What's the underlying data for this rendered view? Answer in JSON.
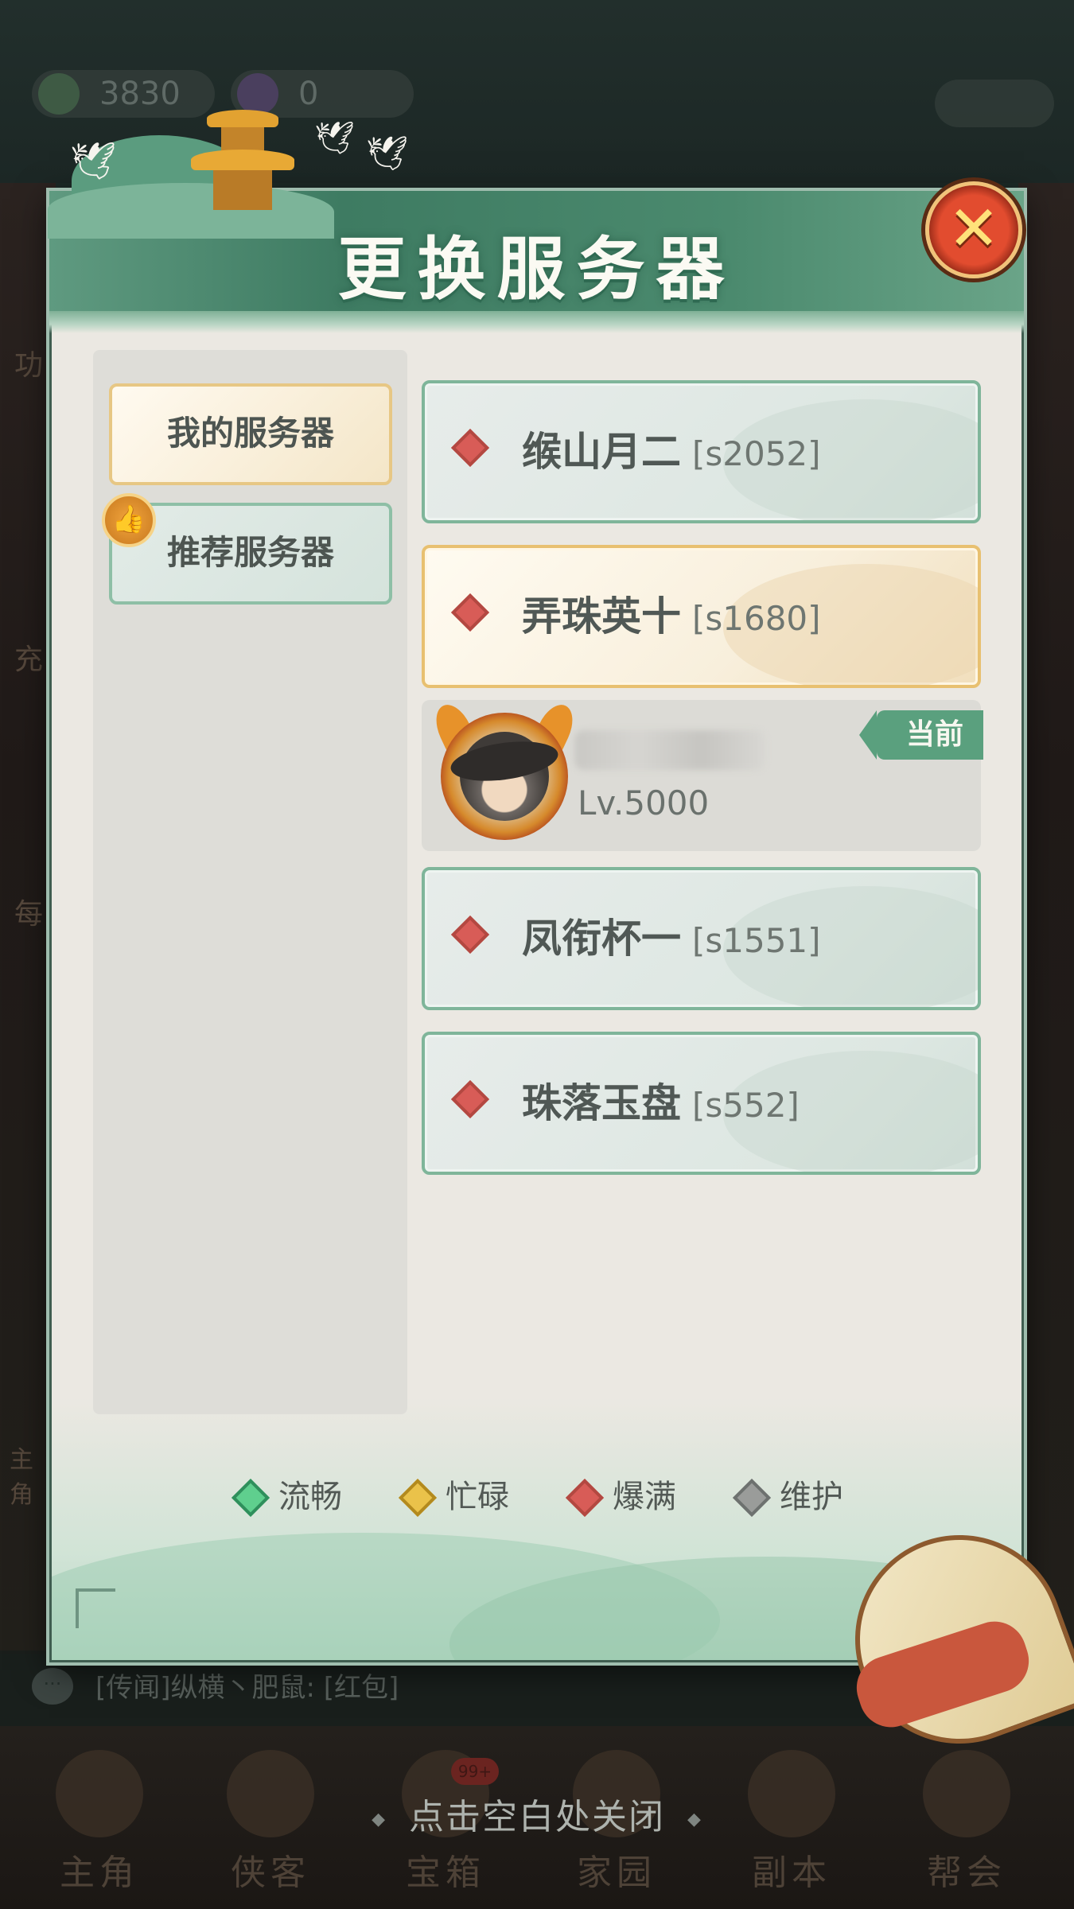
{
  "background": {
    "resource_1": "3830",
    "resource_2": "0",
    "side_left_texts": [
      "功",
      "充",
      "每",
      "主角"
    ],
    "chat": {
      "icon": "chat-bubble-icon",
      "text": "[传闻]纵横丶肥鼠: [红包]"
    },
    "nav": [
      {
        "label": "主角",
        "icon": "hero-icon"
      },
      {
        "label": "侠客",
        "icon": "gourd-icon"
      },
      {
        "label": "宝箱",
        "icon": "chest-icon",
        "badge": "99+"
      },
      {
        "label": "家园",
        "icon": "home-icon"
      },
      {
        "label": "副本",
        "icon": "scroll-map-icon"
      },
      {
        "label": "帮会",
        "icon": "guild-icon"
      }
    ]
  },
  "dialog": {
    "title": "更换服务器",
    "close_icon": "close-x-icon",
    "tabs": [
      {
        "label": "我的服务器",
        "selected": true
      },
      {
        "label": "推荐服务器",
        "selected": false,
        "icon": "thumbs-up-icon"
      }
    ],
    "servers": [
      {
        "name": "缑山月二",
        "code": "[s2052]",
        "status": "爆满"
      },
      {
        "name": "弄珠英十",
        "code": "[s1680]",
        "status": "爆满"
      }
    ],
    "current": {
      "level": "Lv.5000",
      "tag": "当前",
      "avatar_icon": "character-avatar-icon"
    },
    "servers_after": [
      {
        "name": "凤衔杯一",
        "code": "[s1551]",
        "status": "爆满"
      },
      {
        "name": "珠落玉盘",
        "code": "[s552]",
        "status": "爆满"
      }
    ],
    "legend": [
      {
        "label": "流畅",
        "color": "#5fcf8e",
        "border": "#2f8f5c"
      },
      {
        "label": "忙碌",
        "color": "#eac24a",
        "border": "#b38a1e"
      },
      {
        "label": "爆满",
        "color": "#d85c57",
        "border": "#b34841"
      },
      {
        "label": "维护",
        "color": "#9a9c9a",
        "border": "#6d716f"
      }
    ]
  },
  "close_hint": "点击空白处关闭",
  "colors": {
    "header_green": "#3e7b62",
    "full_status": "#d85c57",
    "current_tag": "#5aa07e"
  }
}
